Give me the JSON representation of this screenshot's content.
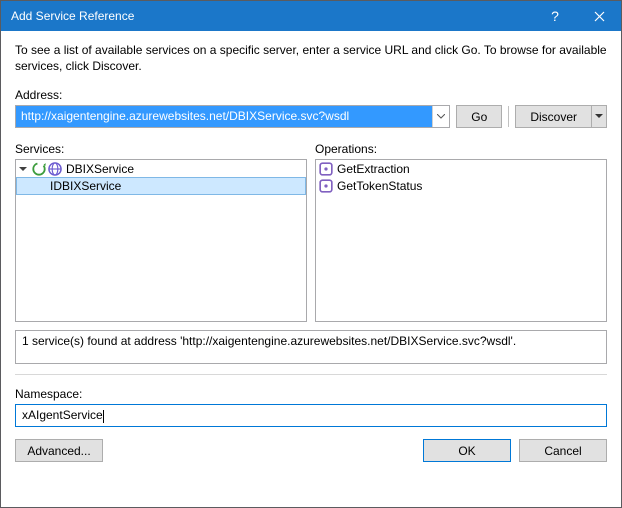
{
  "titlebar": {
    "title": "Add Service Reference"
  },
  "desc": "To see a list of available services on a specific server, enter a service URL and click Go. To browse for available services, click Discover.",
  "labels": {
    "address": "Address:",
    "services": "Services:",
    "operations": "Operations:",
    "namespace": "Namespace:"
  },
  "address": {
    "value": "http://xaigentengine.azurewebsites.net/DBIXService.svc?wsdl"
  },
  "buttons": {
    "go": "Go",
    "discover": "Discover",
    "advanced": "Advanced...",
    "ok": "OK",
    "cancel": "Cancel"
  },
  "services": {
    "root": "DBIXService",
    "contract": "IDBIXService"
  },
  "operations": [
    "GetExtraction",
    "GetTokenStatus"
  ],
  "status": "1 service(s) found at address 'http://xaigentengine.azurewebsites.net/DBIXService.svc?wsdl'.",
  "namespace": {
    "value": "xAIgentService"
  }
}
